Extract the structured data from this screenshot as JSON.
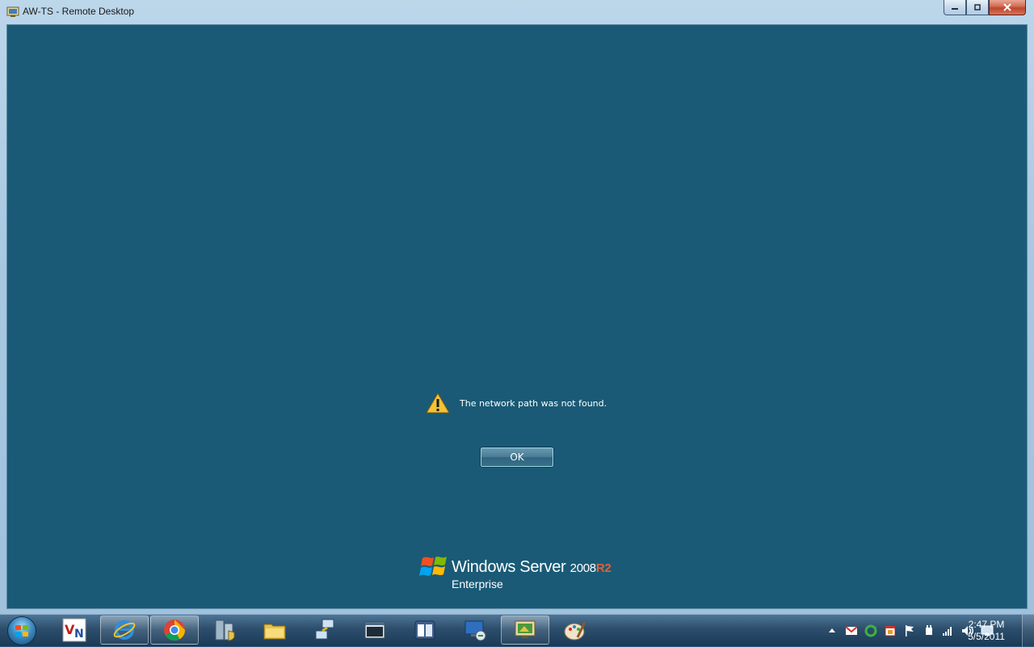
{
  "window": {
    "title": "AW-TS - Remote Desktop",
    "icon": "remote-desktop-icon",
    "caption_buttons": [
      "minimize-icon",
      "restore-icon",
      "close-icon"
    ]
  },
  "dialog": {
    "message": "The network path was not found.",
    "icon": "warning-icon",
    "ok_label": "OK"
  },
  "branding": {
    "product": "Windows Server",
    "version": "2008",
    "release": "R2",
    "edition": "Enterprise"
  },
  "taskbar": {
    "start_icon": "windows-start-orb",
    "items": [
      {
        "name": "vnc-icon",
        "active": false
      },
      {
        "name": "internet-explorer-icon",
        "active": true
      },
      {
        "name": "chrome-icon",
        "active": true
      },
      {
        "name": "server-manager-icon",
        "active": false
      },
      {
        "name": "windows-explorer-icon",
        "active": false
      },
      {
        "name": "network-connections-icon",
        "active": false
      },
      {
        "name": "console-window-icon",
        "active": false
      },
      {
        "name": "document-viewer-icon",
        "active": false
      },
      {
        "name": "remote-desktop-connection-icon",
        "active": false
      },
      {
        "name": "remote-desktop-session-icon",
        "active": true
      },
      {
        "name": "paint-icon",
        "active": false
      }
    ],
    "tray_icons": [
      "show-hidden-icons-arrow",
      "gmail-notifier-icon",
      "sync-icon",
      "calendar-icon",
      "action-center-flag-icon",
      "power-icon",
      "signal-icon",
      "volume-icon",
      "network-icon"
    ],
    "clock": {
      "time": "2:47 PM",
      "date": "5/5/2011"
    }
  },
  "colors": {
    "desktop_background": "#1a5a76",
    "brand_r2": "#e2603a"
  }
}
